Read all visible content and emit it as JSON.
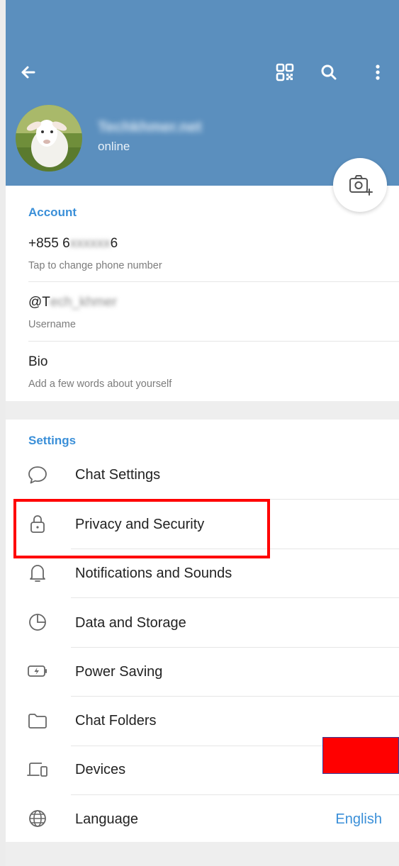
{
  "header": {
    "profile_name": "Techkhmer.net",
    "status": "online",
    "icons": [
      "back-arrow-icon",
      "qr-code-icon",
      "search-icon",
      "more-vert-icon",
      "camera-add-icon"
    ],
    "background_color": "#5b8fbe"
  },
  "account": {
    "section_title": "Account",
    "phone_prefix": "+855 6",
    "phone_hidden": "xxxxxx",
    "phone_suffix": "6",
    "phone_caption": "Tap to change phone number",
    "username_prefix": "@T",
    "username_hidden": "ech_khmer",
    "username_caption": "Username",
    "bio_title": "Bio",
    "bio_caption": "Add a few words about yourself"
  },
  "settings": {
    "section_title": "Settings",
    "items": [
      {
        "label": "Chat Settings",
        "icon": "chat-bubble-icon"
      },
      {
        "label": "Privacy and Security",
        "icon": "lock-icon"
      },
      {
        "label": "Notifications and Sounds",
        "icon": "bell-icon"
      },
      {
        "label": "Data and Storage",
        "icon": "pie-clock-icon"
      },
      {
        "label": "Power Saving",
        "icon": "battery-bolt-icon"
      },
      {
        "label": "Chat Folders",
        "icon": "folder-icon"
      },
      {
        "label": "Devices",
        "icon": "devices-icon"
      },
      {
        "label": "Language",
        "icon": "globe-icon",
        "value": "English"
      }
    ]
  },
  "colors": {
    "accent": "#3a8fd8",
    "highlight": "#ff0000"
  }
}
